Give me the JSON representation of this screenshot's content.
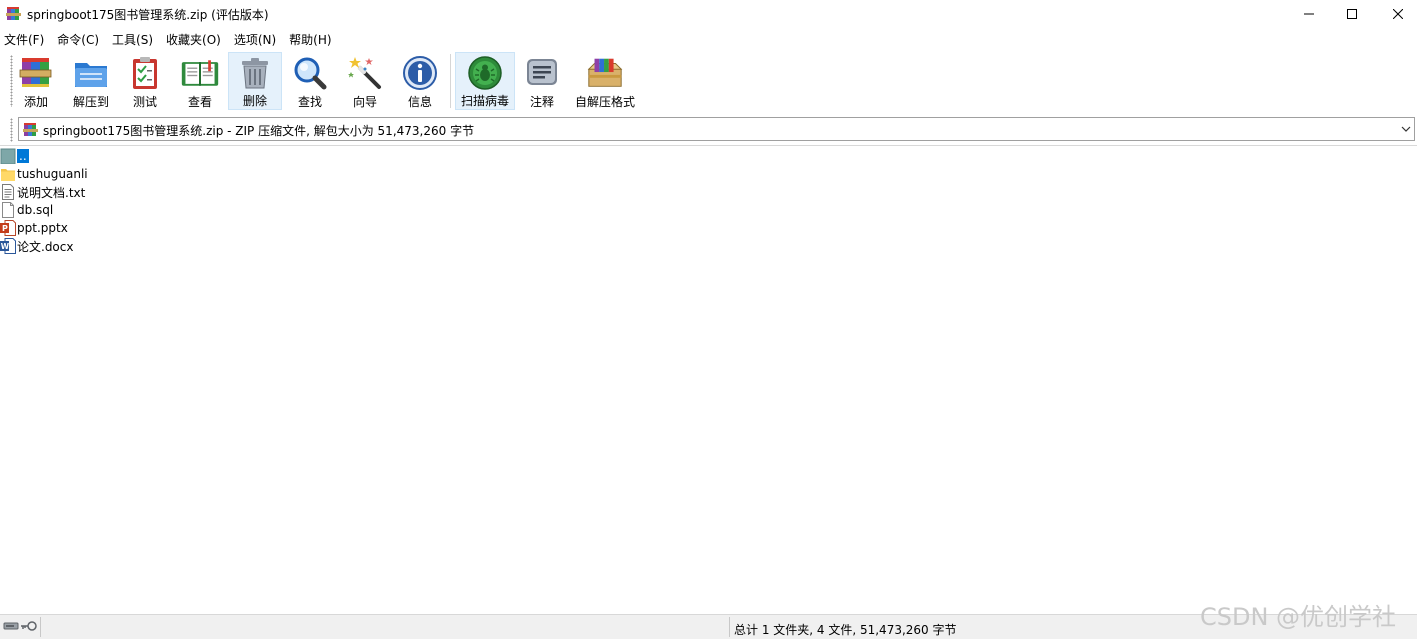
{
  "window": {
    "title": "springboot175图书管理系统.zip (评估版本)",
    "buttons": [
      "minimize",
      "maximize",
      "close"
    ]
  },
  "menu": [
    "文件(F)",
    "命令(C)",
    "工具(S)",
    "收藏夹(O)",
    "选项(N)",
    "帮助(H)"
  ],
  "toolbar": [
    {
      "label": "添加",
      "icon": "add-archive-icon"
    },
    {
      "label": "解压到",
      "icon": "extract-to-icon"
    },
    {
      "label": "测试",
      "icon": "test-icon"
    },
    {
      "label": "查看",
      "icon": "view-icon"
    },
    {
      "label": "删除",
      "icon": "delete-icon"
    },
    {
      "label": "查找",
      "icon": "find-icon"
    },
    {
      "label": "向导",
      "icon": "wizard-icon"
    },
    {
      "label": "信息",
      "icon": "info-icon"
    },
    {
      "label": "扫描病毒",
      "icon": "virus-scan-icon"
    },
    {
      "label": "注释",
      "icon": "comment-icon"
    },
    {
      "label": "自解压格式",
      "icon": "sfx-icon"
    }
  ],
  "path": {
    "text": "springboot175图书管理系统.zip - ZIP 压缩文件, 解包大小为 51,473,260 字节"
  },
  "files": [
    {
      "name": "..",
      "type": "parent-folder",
      "selected": true
    },
    {
      "name": "tushuguanli",
      "type": "folder"
    },
    {
      "name": "说明文档.txt",
      "type": "text"
    },
    {
      "name": "db.sql",
      "type": "file"
    },
    {
      "name": "ppt.pptx",
      "type": "powerpoint"
    },
    {
      "name": "论文.docx",
      "type": "word"
    }
  ],
  "status": {
    "summary": "总计 1 文件夹, 4 文件, 51,473,260 字节"
  },
  "watermark": "CSDN @优创学社"
}
